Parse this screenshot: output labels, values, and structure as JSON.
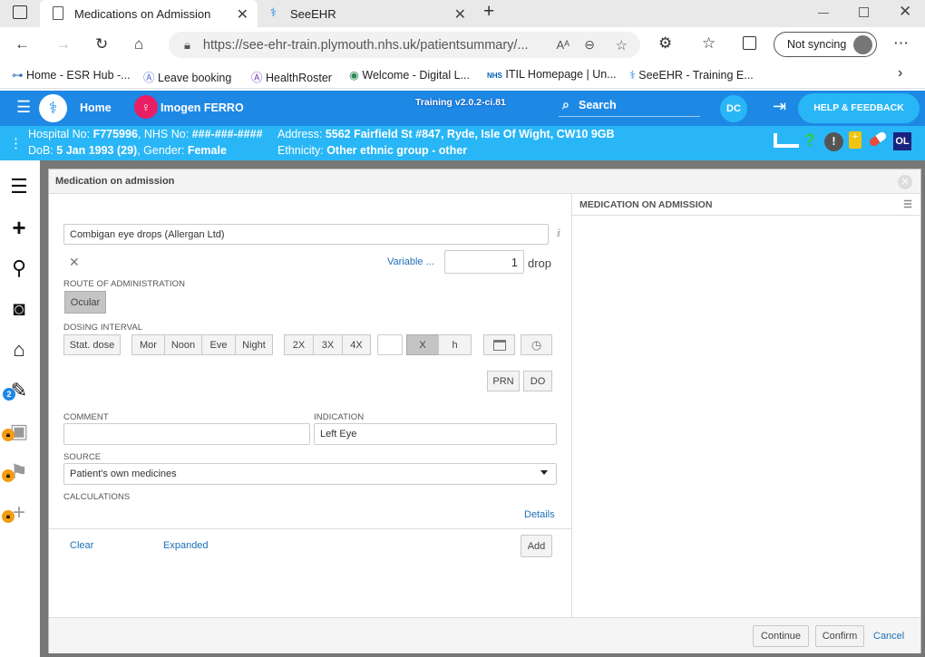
{
  "browser": {
    "tabs": [
      {
        "title": "Medications on Admission"
      },
      {
        "title": "SeeEHR"
      }
    ],
    "url": "https://see-ehr-train.plymouth.nhs.uk/patientsummary/...",
    "sync_label": "Not syncing",
    "favorites": [
      "Home - ESR Hub -...",
      "Leave booking",
      "HealthRoster",
      "Welcome - Digital L...",
      "ITIL Homepage | Un...",
      "SeeEHR - Training E..."
    ]
  },
  "app": {
    "home_label": "Home",
    "patient_name": "Imogen FERRO",
    "version": "Training v2.0.2-ci.81",
    "search_label": "Search",
    "user_initials": "DC",
    "help_label": "HELP & FEEDBACK",
    "accent": "#1e88e5",
    "patient_bar_color": "#29b6f6"
  },
  "patient": {
    "line1_left": "Hospital No: ",
    "hospital_no": "F775996",
    "nhs_prefix": ", NHS No: ",
    "nhs_no": "###-###-####",
    "address_prefix": "Address: ",
    "address": "5562 Fairfield St #847, Ryde, Isle Of Wight, CW10 9GB",
    "dob_prefix": "DoB: ",
    "dob": "5 Jan 1993 (29)",
    "gender_prefix": ", Gender: ",
    "gender": "Female",
    "ethnicity_prefix": "Ethnicity: ",
    "ethnicity": "Other ethnic group - other",
    "badge": "OL"
  },
  "sidebar": {
    "badge_count": "2"
  },
  "modal": {
    "title": "Medication on admission",
    "medication": "Combigan eye drops (Allergan Ltd)",
    "variable_label": "Variable ...",
    "dose_value": "1",
    "dose_unit": "drop",
    "route_label": "ROUTE OF ADMINISTRATION",
    "route_value": "Ocular",
    "dosing_label": "DOSING INTERVAL",
    "stat_dose": "Stat. dose",
    "times": [
      "Mor",
      "Noon",
      "Eve",
      "Night"
    ],
    "freq": [
      "2X",
      "3X",
      "4X"
    ],
    "x_label": "X",
    "h_label": "h",
    "prn": "PRN",
    "do": "DO",
    "comment_label": "COMMENT",
    "comment_value": "",
    "indication_label": "INDICATION",
    "indication_value": "Left Eye",
    "source_label": "SOURCE",
    "source_value": "Patient's own medicines",
    "calc_label": "CALCULATIONS",
    "details": "Details",
    "clear": "Clear",
    "expanded": "Expanded",
    "add": "Add",
    "right_header": "MEDICATION ON ADMISSION",
    "continue": "Continue",
    "confirm": "Confirm",
    "cancel": "Cancel"
  }
}
